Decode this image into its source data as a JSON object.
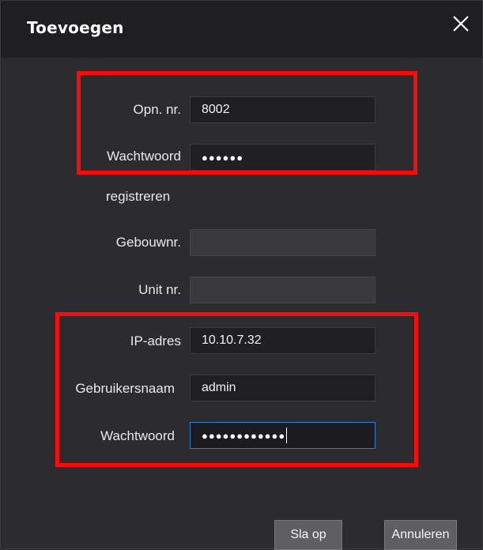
{
  "dialog": {
    "title": "Toevoegen",
    "close_icon": "close-icon"
  },
  "form": {
    "room_no": {
      "label": "Opn. nr.",
      "value": "8002"
    },
    "room_password": {
      "label": "Wachtwoord",
      "value": "●●●●●●"
    },
    "register": {
      "label": "registreren"
    },
    "building_no": {
      "label": "Gebouwnr.",
      "value": ""
    },
    "unit_no": {
      "label": "Unit nr.",
      "value": ""
    },
    "ip_address": {
      "label": "IP-adres",
      "value": "10.10.7.32"
    },
    "username": {
      "label": "Gebruikersnaam",
      "value": "admin"
    },
    "password": {
      "label": "Wachtwoord",
      "value": "●●●●●●●●●●●●"
    }
  },
  "buttons": {
    "save": "Sla op",
    "cancel": "Annuleren"
  },
  "colors": {
    "highlight": "#ff0a0a",
    "focus": "#2f7fd0",
    "background": "#2c2c30",
    "titlebar": "#1f1f22"
  }
}
